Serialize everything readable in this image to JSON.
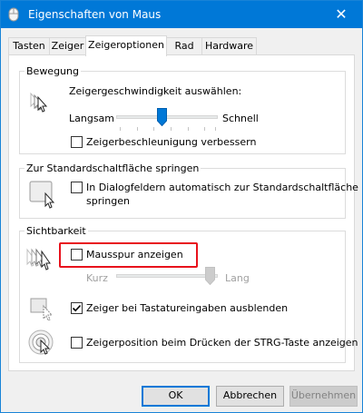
{
  "window": {
    "title": "Eigenschaften von Maus",
    "close_glyph": "✕"
  },
  "tabs": [
    {
      "label": "Tasten"
    },
    {
      "label": "Zeiger"
    },
    {
      "label": "Zeigeroptionen",
      "active": true
    },
    {
      "label": "Rad"
    },
    {
      "label": "Hardware"
    }
  ],
  "motion": {
    "group_label": "Bewegung",
    "speed_label": "Zeigergeschwindigkeit auswählen:",
    "slow_label": "Langsam",
    "fast_label": "Schnell",
    "speed_level": 0.5,
    "precision_label": "Zeigerbeschleunigung verbessern",
    "precision_checked": false
  },
  "snap": {
    "group_label": "Zur Standardschaltfläche springen",
    "line1": "In Dialogfeldern automatisch zur Standardschaltfläche",
    "line2": "springen",
    "checked": false
  },
  "visibility": {
    "group_label": "Sichtbarkeit",
    "trails_label": "Mausspur anzeigen",
    "trails_checked": false,
    "short_label": "Kurz",
    "long_label": "Lang",
    "trail_level": 1.0,
    "hide_label": "Zeiger bei Tastatureingaben ausblenden",
    "hide_checked": true,
    "ctrl_label": "Zeigerposition beim Drücken der STRG-Taste anzeigen",
    "ctrl_checked": false
  },
  "buttons": {
    "ok": "OK",
    "cancel": "Abbrechen",
    "apply": "Übernehmen"
  },
  "colors": {
    "titlebar": "#0078d7",
    "highlight": "#e8121c"
  }
}
